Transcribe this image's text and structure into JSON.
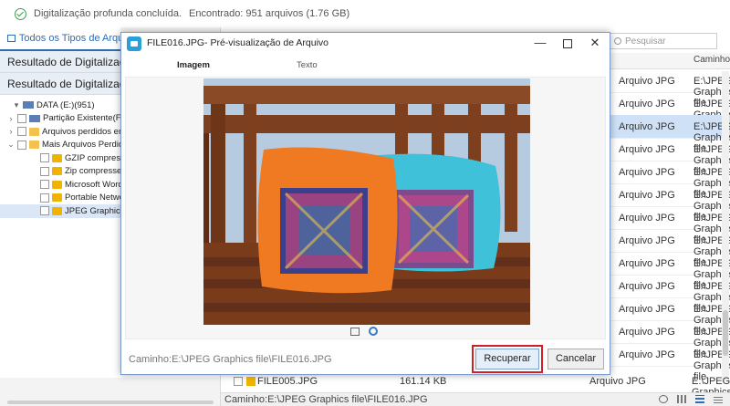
{
  "status": {
    "message": "Digitalização profunda concluída.",
    "found": "Encontrado: 951 arquivos (1.76 GB)"
  },
  "left": {
    "tab_label": "Todos os Tipos de Arquivo",
    "results": [
      "Resultado de Digitalização",
      "Resultado de Digitalização"
    ],
    "tree": [
      {
        "label": "DATA (E:)(951)",
        "level": 0
      },
      {
        "label": "Partição Existente(F:)",
        "level": 1
      },
      {
        "label": "Arquivos perdidos encontrados",
        "level": 1
      },
      {
        "label": "Mais Arquivos Perdidos",
        "level": 1
      },
      {
        "label": "GZIP compressed file",
        "level": 2
      },
      {
        "label": "Zip compressed file",
        "level": 2
      },
      {
        "label": "Microsoft Word Document",
        "level": 2
      },
      {
        "label": "Portable Network Graphics",
        "level": 2
      },
      {
        "label": "JPEG Graphics file",
        "level": 2
      }
    ]
  },
  "search": {
    "placeholder": "Pesquisar"
  },
  "table": {
    "path_header": "Caminho",
    "rows": [
      {
        "type": "Arquivo JPG",
        "path": "E:\\JPEG Graphics file"
      },
      {
        "type": "Arquivo JPG",
        "path": "E:\\JPEG Graphics file"
      },
      {
        "type": "Arquivo JPG",
        "path": "E:\\JPEG Graphics file"
      },
      {
        "type": "Arquivo JPG",
        "path": "E:\\JPEG Graphics file"
      },
      {
        "type": "Arquivo JPG",
        "path": "E:\\JPEG Graphics file"
      },
      {
        "type": "Arquivo JPG",
        "path": "E:\\JPEG Graphics file"
      },
      {
        "type": "Arquivo JPG",
        "path": "E:\\JPEG Graphics file"
      },
      {
        "type": "Arquivo JPG",
        "path": "E:\\JPEG Graphics file"
      },
      {
        "type": "Arquivo JPG",
        "path": "E:\\JPEG Graphics file"
      },
      {
        "type": "Arquivo JPG",
        "path": "E:\\JPEG Graphics file"
      },
      {
        "type": "Arquivo JPG",
        "path": "E:\\JPEG Graphics file"
      },
      {
        "type": "Arquivo JPG",
        "path": "E:\\JPEG Graphics file"
      },
      {
        "type": "Arquivo JPG",
        "path": "E:\\JPEG Graphics file"
      }
    ],
    "partial_row": {
      "name": "FILE005.JPG",
      "size": "161.14 KB",
      "type": "Arquivo JPG",
      "path": "E:\\JPEG Graphics file"
    }
  },
  "bottom": {
    "path": "Caminho:E:\\JPEG Graphics file\\FILE016.JPG"
  },
  "dialog": {
    "title": "FILE016.JPG- Pré-visualização de Arquivo",
    "tabs": {
      "image": "Imagem",
      "text": "Texto"
    },
    "path": "Caminho:E:\\JPEG Graphics file\\FILE016.JPG",
    "recover_label": "Recuperar",
    "cancel_label": "Cancelar",
    "close_glyph": "✕",
    "minimize_glyph": "—"
  },
  "colors": {
    "accent": "#2e6db4",
    "highlight_outline": "#d21f26",
    "selected_row": "#cfe1f7"
  }
}
